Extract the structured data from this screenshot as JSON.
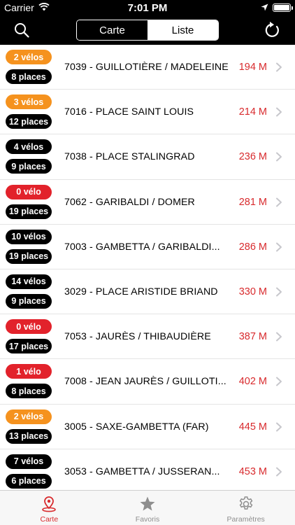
{
  "status_bar": {
    "carrier": "Carrier",
    "time": "7:01 PM",
    "icons": [
      "wifi-icon",
      "location-arrow-icon",
      "battery-icon"
    ]
  },
  "nav": {
    "search_icon": "search-icon",
    "refresh_icon": "refresh-icon",
    "segments": [
      {
        "label": "Carte",
        "selected": false
      },
      {
        "label": "Liste",
        "selected": true
      }
    ]
  },
  "stations": [
    {
      "bikes": "2 vélos",
      "bikes_color": "orange",
      "places": "8 places",
      "name": "7039 - GUILLOTIÈRE / MADELEINE",
      "distance": "194 M"
    },
    {
      "bikes": "3 vélos",
      "bikes_color": "orange",
      "places": "12 places",
      "name": "7016 - PLACE SAINT LOUIS",
      "distance": "214 M"
    },
    {
      "bikes": "4 vélos",
      "bikes_color": "black",
      "places": "9 places",
      "name": "7038 - PLACE STALINGRAD",
      "distance": "236 M"
    },
    {
      "bikes": "0 vélo",
      "bikes_color": "red",
      "places": "19 places",
      "name": "7062 - GARIBALDI / DOMER",
      "distance": "281 M"
    },
    {
      "bikes": "10 vélos",
      "bikes_color": "black",
      "places": "19 places",
      "name": "7003 - GAMBETTA / GARIBALDI...",
      "distance": "286 M"
    },
    {
      "bikes": "14 vélos",
      "bikes_color": "black",
      "places": "9 places",
      "name": "3029 - PLACE ARISTIDE BRIAND",
      "distance": "330 M"
    },
    {
      "bikes": "0 vélo",
      "bikes_color": "red",
      "places": "17 places",
      "name": "7053 - JAURÈS / THIBAUDIÈRE",
      "distance": "387 M"
    },
    {
      "bikes": "1 vélo",
      "bikes_color": "red",
      "places": "8 places",
      "name": "7008 - JEAN JAURÈS / GUILLOTI...",
      "distance": "402 M"
    },
    {
      "bikes": "2 vélos",
      "bikes_color": "orange",
      "places": "13 places",
      "name": "3005 - SAXE-GAMBETTA (FAR)",
      "distance": "445 M"
    },
    {
      "bikes": "7 vélos",
      "bikes_color": "black",
      "places": "6 places",
      "name": "3053 - GAMBETTA / JUSSERAN...",
      "distance": "453 M"
    }
  ],
  "tab_bar": {
    "tabs": [
      {
        "label": "Carte",
        "icon": "map-pin-icon",
        "active": true
      },
      {
        "label": "Favoris",
        "icon": "star-icon",
        "active": false
      },
      {
        "label": "Paramètres",
        "icon": "gear-icon",
        "active": false
      }
    ]
  },
  "colors": {
    "accent": "#d82a2d",
    "orange": "#f5921e",
    "red": "#e2222b",
    "black": "#000000",
    "inactive_tab": "#8e8e8e"
  }
}
